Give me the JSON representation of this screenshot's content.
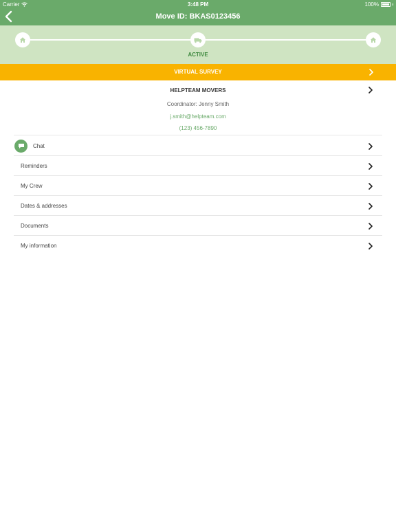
{
  "status_bar": {
    "carrier": "Carrier",
    "time": "3:48 PM",
    "battery": "100%"
  },
  "nav": {
    "title": "Move ID: BKAS0123456",
    "back_icon": "chevron-left-icon"
  },
  "progress": {
    "status": "ACTIVE",
    "steps": [
      {
        "icon": "house-icon"
      },
      {
        "icon": "truck-icon"
      },
      {
        "icon": "house-icon"
      }
    ]
  },
  "survey": {
    "label": "VIRTUAL SURVEY"
  },
  "company": {
    "name": "HELPTEAM MOVERS",
    "coordinator": "Coordinator: Jenny Smith",
    "email": "j.smith@helpteam.com",
    "phone": "(123) 456-7890"
  },
  "menu": {
    "items": [
      {
        "label": "Chat"
      },
      {
        "label": "Reminders"
      },
      {
        "label": "My Crew"
      },
      {
        "label": "Dates & addresses"
      },
      {
        "label": "Documents"
      },
      {
        "label": "My information"
      }
    ]
  },
  "colors": {
    "primary_green": "#6aaa6a",
    "light_green": "#cfe4c2",
    "accent_yellow": "#f9b300",
    "divider": "#e6e6e6"
  }
}
